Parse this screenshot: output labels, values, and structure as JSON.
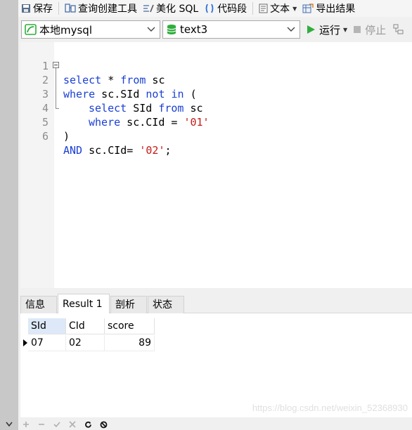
{
  "toolbar": {
    "save_label": "保存",
    "query_builder_label": "查询创建工具",
    "beautify_label": "美化 SQL",
    "snippet_label": "代码段",
    "text_label": "文本",
    "export_label": "导出结果"
  },
  "connection": {
    "connection_value": "本地mysql",
    "database_value": "text3",
    "run_label": "运行",
    "stop_label": "停止"
  },
  "editor": {
    "line_numbers": [
      "1",
      "2",
      "3",
      "4",
      "5",
      "6"
    ],
    "lines": [
      [
        "select",
        " * ",
        "from",
        " sc"
      ],
      [
        "where",
        " sc.SId ",
        "not",
        " ",
        "in",
        " ("
      ],
      [
        "select",
        " SId ",
        "from",
        " sc"
      ],
      [
        "where",
        " sc.CId = ",
        "'01'"
      ],
      [
        ")"
      ],
      [
        "AND",
        " sc.CId= ",
        "'02'",
        ";"
      ]
    ]
  },
  "result_tabs": [
    "信息",
    "Result 1",
    "剖析",
    "状态"
  ],
  "result_grid": {
    "columns": [
      "SId",
      "CId",
      "score"
    ],
    "rows": [
      [
        "07",
        "02",
        "89"
      ]
    ]
  },
  "watermark": "https://blog.csdn.net/weixin_52368930",
  "colors": {
    "keyword": "#1a3fd6",
    "string": "#c41a16",
    "run_green": "#2fae3c",
    "header_selected": "#dde9f8"
  },
  "icons": [
    "save-icon",
    "query-builder-icon",
    "beautify-icon",
    "snippet-icon",
    "text-icon",
    "export-icon",
    "mysql-connection-icon",
    "database-icon",
    "run-icon",
    "stop-icon",
    "explain-icon",
    "add-record-icon",
    "delete-record-icon",
    "apply-icon",
    "discard-icon",
    "refresh-icon",
    "stop-query-icon"
  ]
}
